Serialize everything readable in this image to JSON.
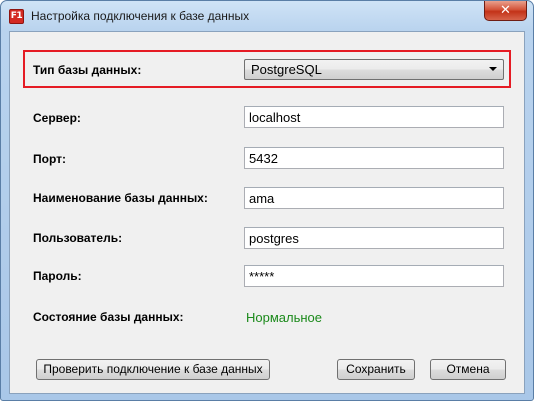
{
  "window": {
    "title": "Настройка подключения к базе данных",
    "app_icon_text": "F1",
    "close_symbol": "✕"
  },
  "form": {
    "db_type": {
      "label": "Тип базы данных:",
      "value": "PostgreSQL"
    },
    "server": {
      "label": "Сервер:",
      "value": "localhost"
    },
    "port": {
      "label": "Порт:",
      "value": "5432"
    },
    "db_name": {
      "label": "Наименование базы данных:",
      "value": "ama"
    },
    "user": {
      "label": "Пользователь:",
      "value": "postgres"
    },
    "password": {
      "label": "Пароль:",
      "value": "*****"
    },
    "status": {
      "label": "Состояние базы данных:",
      "value": "Нормальное"
    }
  },
  "buttons": {
    "test": "Проверить подключение к базе данных",
    "save": "Сохранить",
    "cancel": "Отмена"
  },
  "colors": {
    "highlight": "#e51b24",
    "status_ok": "#1b8a1b"
  }
}
